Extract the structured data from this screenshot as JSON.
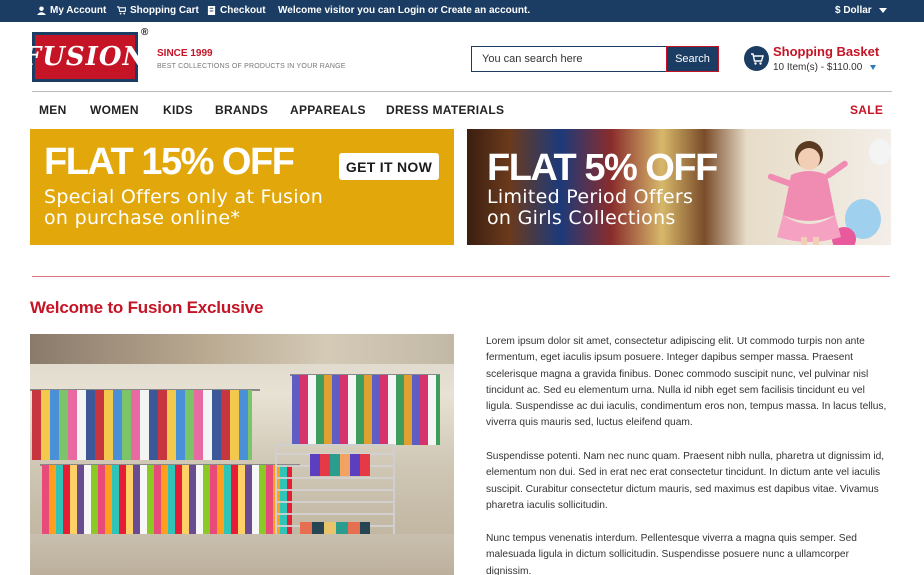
{
  "topbar": {
    "my_account": "My Account",
    "shopping_cart": "Shopping Cart",
    "checkout": "Checkout",
    "welcome": "Welcome visitor you can Login or Create an account.",
    "currency": "$ Dollar"
  },
  "header": {
    "logo_text": "FUSION",
    "registered": "®",
    "since": "SINCE 1999",
    "tagline": "BEST COLLECTIONS OF PRODUCTS IN YOUR RANGE",
    "search_placeholder": "You can search here",
    "search_button": "Search",
    "basket_title": "Shopping Basket",
    "basket_items": "10 Item(s) - $110.00"
  },
  "nav": {
    "items": [
      "MEN",
      "WOMEN",
      "KIDS",
      "BRANDS",
      "APPAREALS",
      "DRESS MATERIALS"
    ],
    "sale": "SALE"
  },
  "banners": [
    {
      "headline": "FLAT 15% OFF",
      "line1": "Special Offers only at Fusion",
      "line2": "on purchase online*",
      "button": "GET IT NOW",
      "bg": "#e2a70a"
    },
    {
      "headline": "FLAT 5% OFF",
      "line1": "Limited Period Offers",
      "line2": "on Girls Collections"
    }
  ],
  "main": {
    "title": "Welcome to Fusion Exclusive",
    "paragraphs": [
      "Lorem ipsum dolor sit amet, consectetur adipiscing elit. Ut commodo turpis non ante fermentum, eget iaculis ipsum posuere. Integer dapibus semper massa. Praesent scelerisque magna a gravida finibus. Donec commodo suscipit nunc, vel pulvinar nisl tincidunt ac. Sed eu elementum urna. Nulla id nibh eget sem facilisis tincidunt eu vel ligula. Suspendisse ac dui iaculis, condimentum eros non, tempus massa. In lacus tellus, viverra quis mauris sed, luctus eleifend quam.",
      "Suspendisse potenti. Nam nec nunc quam. Praesent nibh nulla, pharetra ut dignis­sim id, elementum non dui. Sed in erat nec erat consectetur tincidunt. In dictum ante vel iaculis suscipit. Curabitur consectetur dictum mauris, sed maximus est dapibus vitae. Vivamus pharetra iaculis sollicitudin.",
      "Nunc tempus venenatis interdum. Pellentesque viverra a magna quis semper. Sed malesuada ligula in dictum sollicitudin. Suspendisse posuere nunc a ullamcorper dignissim."
    ]
  },
  "colors": {
    "brand_navy": "#1b3c63",
    "brand_red": "#c41426",
    "banner_gold": "#e2a70a"
  }
}
